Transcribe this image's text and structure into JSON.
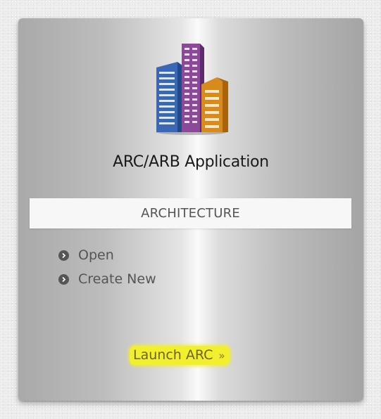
{
  "tile": {
    "title": "ARC/ARB Application",
    "category": "ARCHITECTURE",
    "logo_icon": "office-buildings-icon",
    "actions": [
      {
        "label": "Open",
        "icon": "circle-chevron-right-icon"
      },
      {
        "label": "Create New",
        "icon": "circle-chevron-right-icon"
      }
    ],
    "launch": {
      "label": "Launch ARC",
      "chevron": "»",
      "highlight_color": "#f2ef2e"
    }
  },
  "colors": {
    "building_blue": "#3a68b4",
    "building_purple": "#8a4a99",
    "building_orange": "#d98a1c",
    "text_dark": "#1a1a1a",
    "text_gray": "#555555"
  }
}
